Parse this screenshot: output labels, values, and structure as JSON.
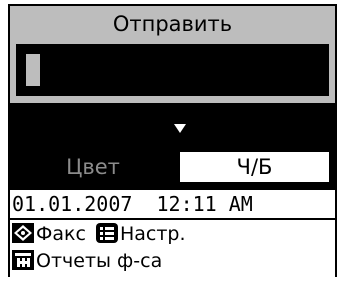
{
  "screen": {
    "title": "Отправить",
    "mode": {
      "color_label": "Цвет",
      "bw_label": "Ч/Б",
      "selected": "Ч/Б"
    },
    "datetime": "01.01.2007  12:11 AM",
    "menu": {
      "fax_label": "Факс",
      "settings_label": "Настр.",
      "reports_label": "Отчеты ф-са"
    }
  },
  "colors": {
    "background": "#000000",
    "panel_gray": "#bdbdbd",
    "text_dim": "#8c8c8c",
    "white": "#ffffff"
  },
  "icons": {
    "start": "start-diamond-icon",
    "menu": "menu-list-icon",
    "reports": "reports-icon",
    "scroll": "arrow-down-icon"
  }
}
